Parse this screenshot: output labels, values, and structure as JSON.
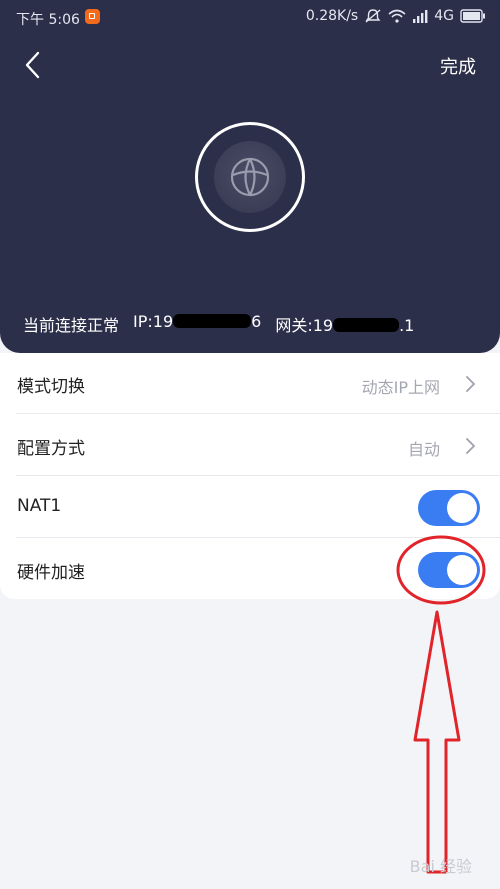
{
  "status_bar": {
    "time": "下午 5:06",
    "network_speed": "0.28K/s",
    "network_type": "4G"
  },
  "header": {
    "done_label": "完成",
    "connection_status": "当前连接正常",
    "ip_prefix": "IP:19",
    "ip_suffix": "6",
    "gateway_prefix": "网关:19",
    "gateway_suffix": ".1"
  },
  "settings": {
    "mode": {
      "label": "模式切换",
      "value": "动态IP上网"
    },
    "config": {
      "label": "配置方式",
      "value": "自动"
    },
    "nat": {
      "label": "NAT1",
      "enabled": true
    },
    "hw_accel": {
      "label": "硬件加速",
      "enabled": true
    }
  },
  "watermark": "Bai 经验",
  "colors": {
    "header_bg": "#2c2f4a",
    "toggle_on": "#3a7cf2",
    "annotation": "#e0242a"
  },
  "icons": [
    "back-chevron-icon",
    "globe-icon",
    "chevron-right-icon",
    "wifi-icon",
    "signal-icon",
    "battery-icon",
    "mute-icon"
  ]
}
